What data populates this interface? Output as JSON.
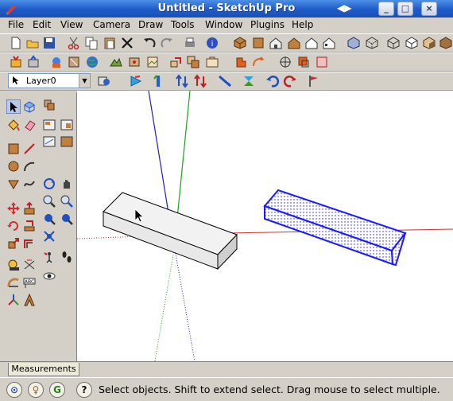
{
  "window": {
    "title": "Untitled - SketchUp Pro",
    "controls": {
      "minimize": "_",
      "maximize": "□",
      "close": "×"
    }
  },
  "menu": [
    "File",
    "Edit",
    "View",
    "Camera",
    "Draw",
    "Tools",
    "Window",
    "Plugins",
    "Help"
  ],
  "layer": {
    "current": "Layer0"
  },
  "measurements": {
    "label": "Measurements"
  },
  "status": {
    "message": "Select objects. Shift to extend select. Drag mouse to select multiple."
  },
  "colors": {
    "title_bar": "#1e5bc8",
    "red_axis": "#d03030",
    "green_axis": "#20a020",
    "blue_axis": "#2020c0",
    "selection": "#1a1aff"
  },
  "toolbar_row1_icons": [
    "new-icon",
    "open-icon",
    "save-icon",
    "cut-icon",
    "copy-icon",
    "paste-icon",
    "erase-icon",
    "undo-icon",
    "redo-icon",
    "print-icon",
    "model-info-icon",
    "iso-view-icon",
    "top-view-icon",
    "front-view-icon",
    "right-view-icon",
    "back-view-icon",
    "left-view-icon",
    "xray-icon",
    "back-edges-icon",
    "wireframe-icon",
    "hidden-line-icon",
    "shaded-icon",
    "shaded-textures-icon",
    "monochrome-icon"
  ],
  "toolbar_row2_icons": [
    "get-models-icon",
    "share-model-icon",
    "share-component-icon",
    "photo-textures-icon",
    "preview-earth-icon",
    "toggle-terrain-icon",
    "add-location-icon",
    "get-photo-texture-icon",
    "follow-me-icon",
    "intersect-icon",
    "outer-shell-icon",
    "union-icon",
    "subtract-icon",
    "trim-icon",
    "split-icon",
    "section-plane-icon",
    "section-cuts-icon"
  ],
  "toolbar_row3_icons": [
    "layers-icon",
    "color-by-layer-icon",
    "red-axis-icon",
    "green-axis-icon",
    "blue-axis-icon",
    "scale-icon",
    "flip-icon",
    "rotate-icon",
    "mirror-icon"
  ],
  "tool_palette_icons": [
    "select-icon",
    "component-icon",
    "paint-bucket-icon",
    "eraser-icon",
    "rectangle-icon",
    "line-icon",
    "circle-icon",
    "arc-icon",
    "polygon-icon",
    "freehand-icon",
    "move-icon",
    "push-pull-icon",
    "rotate-icon",
    "follow-me-icon",
    "scale-icon",
    "offset-icon",
    "tape-measure-icon",
    "dimension-icon",
    "protractor-icon",
    "text-icon",
    "axes-icon",
    "3d-text-icon",
    "orbit-icon",
    "pan-icon",
    "zoom-icon",
    "zoom-window-icon",
    "zoom-extents-icon",
    "previous-icon",
    "position-camera-icon",
    "walk-icon",
    "look-around-icon",
    "section-plane-icon"
  ]
}
